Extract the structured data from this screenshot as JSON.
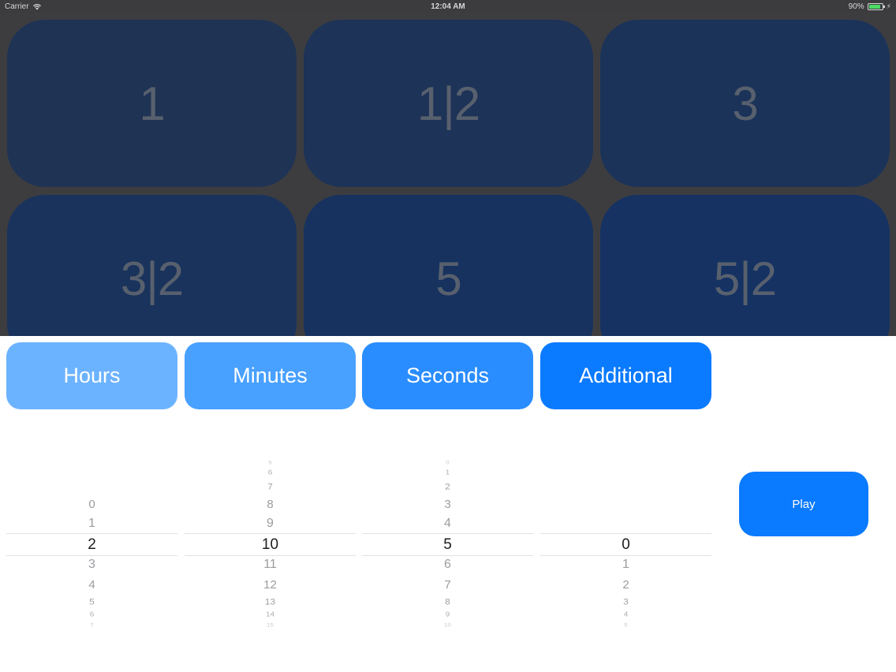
{
  "status_bar": {
    "carrier": "Carrier",
    "time": "12:04 AM",
    "battery": "90%",
    "battery_level": 0.9
  },
  "tiles": [
    {
      "label": "1",
      "color": "#1f3354"
    },
    {
      "label": "1|2",
      "color": "#1d3357"
    },
    {
      "label": "3",
      "color": "#1b3359"
    },
    {
      "label": "3|2",
      "color": "#1a335c"
    },
    {
      "label": "5",
      "color": "#17325f"
    },
    {
      "label": "5|2",
      "color": "#153263"
    }
  ],
  "segments": [
    {
      "label": "Hours",
      "color": "#6cb3ff"
    },
    {
      "label": "Minutes",
      "color": "#48a0ff"
    },
    {
      "label": "Seconds",
      "color": "#2a8dff"
    },
    {
      "label": "Additional",
      "color": "#0a7aff"
    }
  ],
  "pickers": [
    {
      "name": "hours",
      "above": [
        "0",
        "1"
      ],
      "selected": "2",
      "below": [
        "3",
        "4",
        "5",
        "6",
        "7"
      ]
    },
    {
      "name": "minutes",
      "above": [
        "5",
        "6",
        "7",
        "8",
        "9"
      ],
      "selected": "10",
      "below": [
        "11",
        "12",
        "13",
        "14",
        "15"
      ]
    },
    {
      "name": "seconds",
      "above": [
        "0",
        "1",
        "2",
        "3",
        "4"
      ],
      "selected": "5",
      "below": [
        "6",
        "7",
        "8",
        "9",
        "10"
      ]
    },
    {
      "name": "additional",
      "above": [],
      "selected": "0",
      "below": [
        "1",
        "2",
        "3",
        "4",
        "5"
      ]
    }
  ],
  "play_button": {
    "label": "Play"
  }
}
